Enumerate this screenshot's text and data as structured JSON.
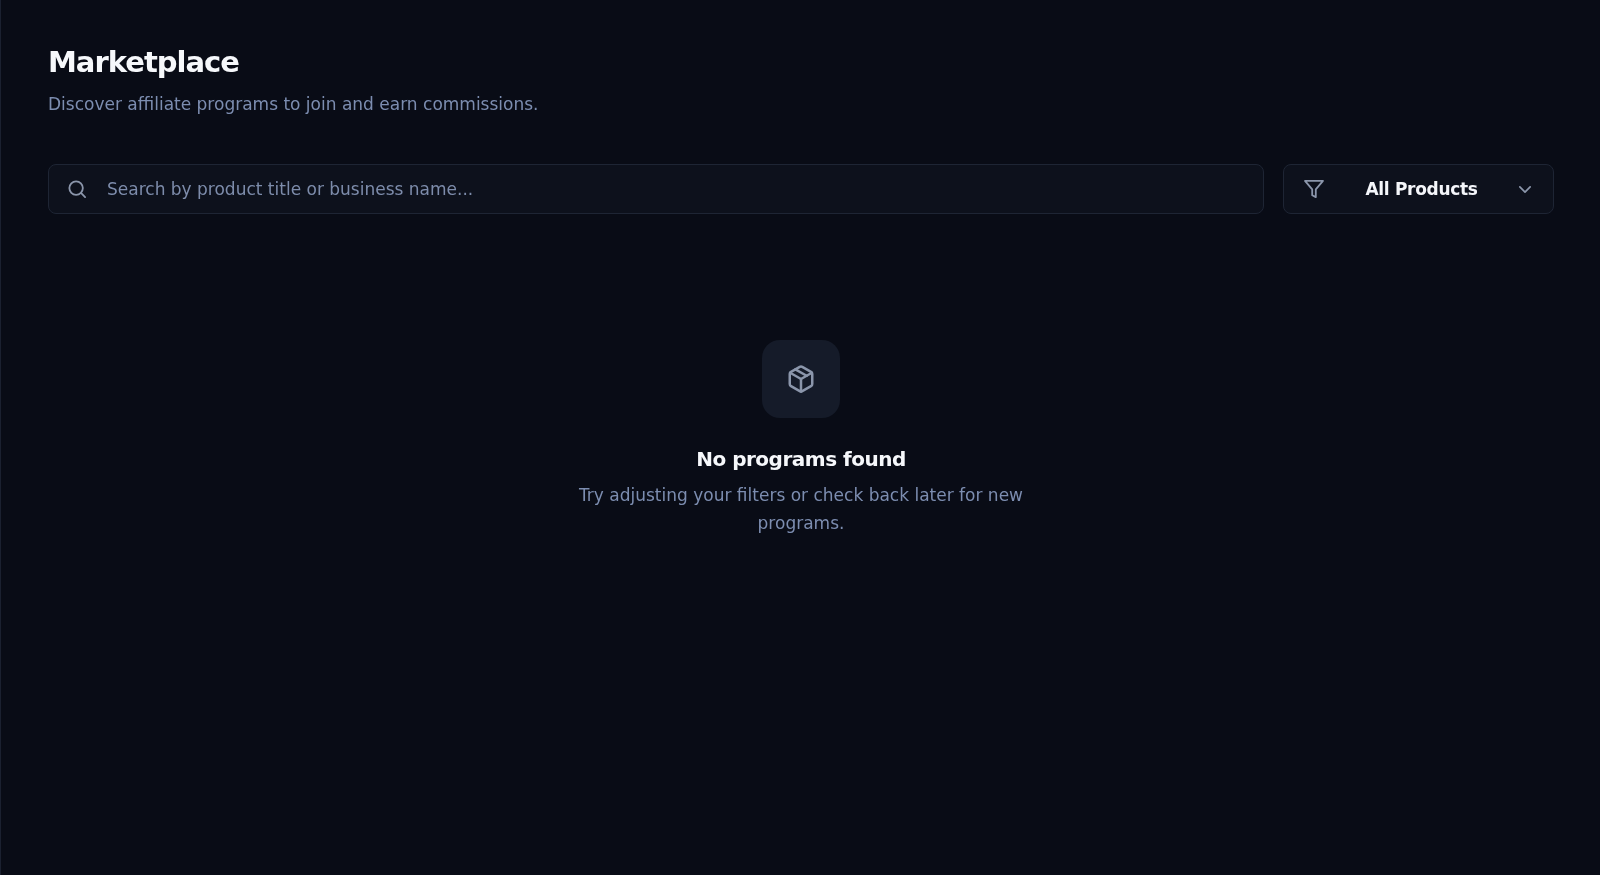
{
  "page": {
    "title": "Marketplace",
    "subtitle": "Discover affiliate programs to join and earn commissions."
  },
  "search": {
    "placeholder": "Search by product title or business name..."
  },
  "filter": {
    "value": "All Products"
  },
  "empty_state": {
    "title": "No programs found",
    "message": "Try adjusting your filters or check back later for new programs."
  }
}
